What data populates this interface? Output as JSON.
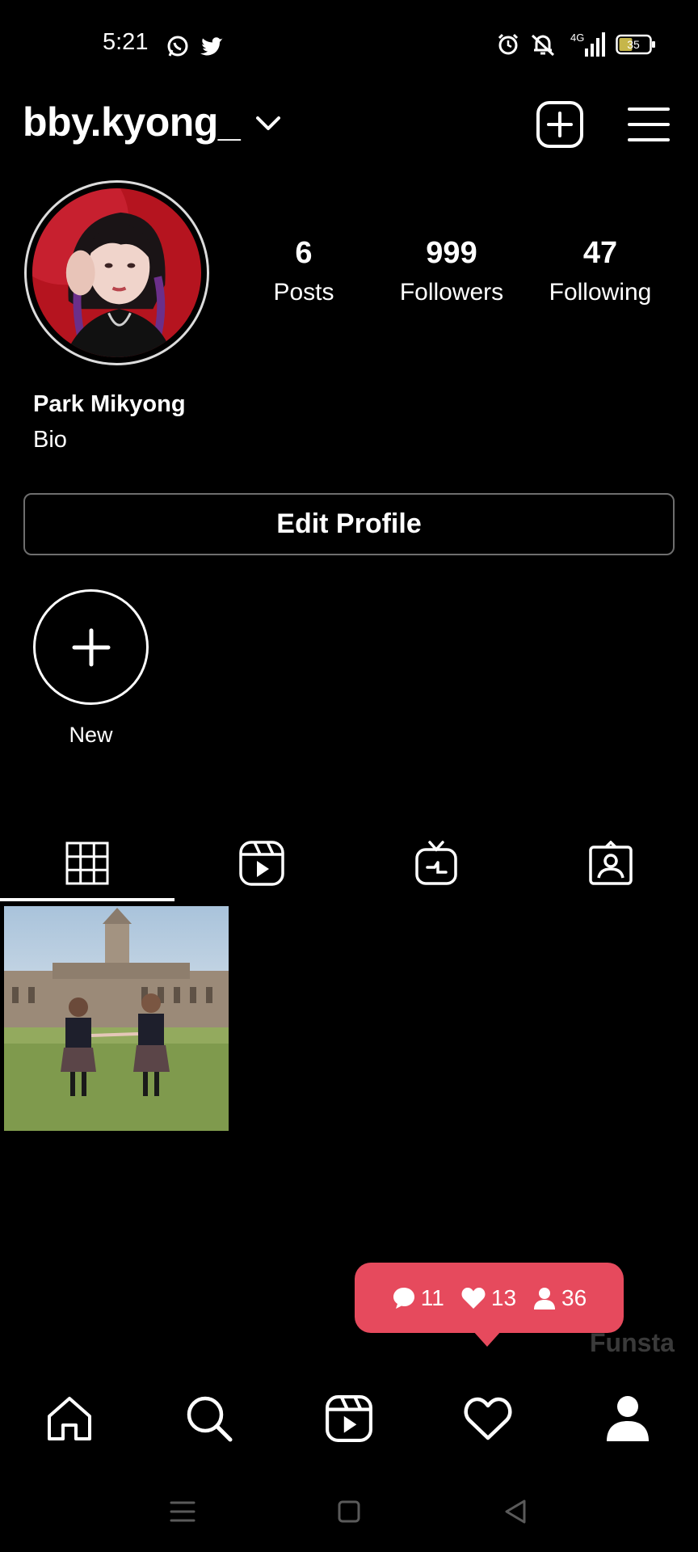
{
  "status_bar": {
    "time": "5:21",
    "network": "4G",
    "battery": "35",
    "icons": [
      "whatsapp-icon",
      "twitter-icon",
      "alarm-icon",
      "mute-icon",
      "signal-icon",
      "battery-icon"
    ]
  },
  "header": {
    "username": "bby.kyong_",
    "icons": [
      "chevron-down-icon",
      "new-post-icon",
      "menu-icon"
    ]
  },
  "profile": {
    "stats": [
      {
        "value": "6",
        "label": "Posts"
      },
      {
        "value": "999",
        "label": "Followers"
      },
      {
        "value": "47",
        "label": "Following"
      }
    ],
    "name": "Park Mikyong",
    "bio": "Bio",
    "edit_button": "Edit Profile"
  },
  "highlights": {
    "new_label": "New"
  },
  "tabs": [
    "grid-icon",
    "reels-icon",
    "igtv-icon",
    "tagged-icon"
  ],
  "notification": {
    "comments": "11",
    "likes": "13",
    "follows": "36"
  },
  "watermark": "Funsta",
  "bottom_nav": [
    "home-icon",
    "search-icon",
    "reels-icon",
    "heart-icon",
    "profile-icon"
  ],
  "colors": {
    "background": "#000000",
    "notification": "#e64a5d",
    "text": "#ffffff"
  }
}
